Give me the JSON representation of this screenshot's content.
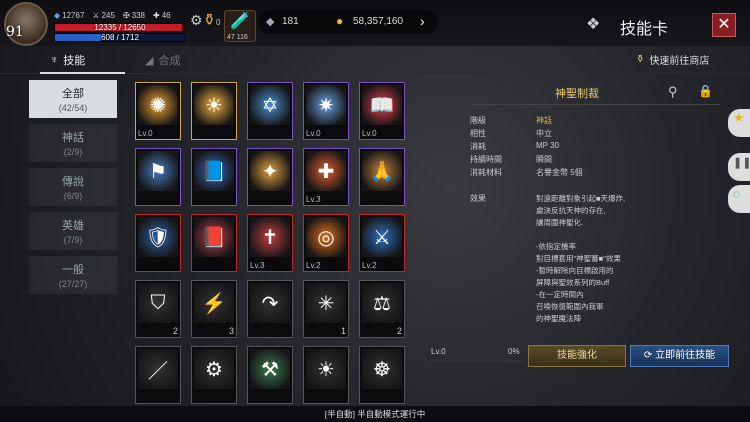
{
  "player": {
    "level": "91",
    "stat1": "12767",
    "stat2": "245",
    "stat3": "338",
    "stat4": "46",
    "hp": "12335 / 12650",
    "mp": "608 / 1712",
    "hp_ratio": 0.975,
    "mp_ratio": 0.355,
    "buff_count": "0",
    "potion_count": "47 116"
  },
  "currency": {
    "crystals": "181",
    "gold": "58,357,160"
  },
  "header": {
    "title": "技能卡",
    "close": "✕"
  },
  "tabs": {
    "skills": "技能",
    "craft": "合成",
    "shop": "快速前往商店"
  },
  "categories": [
    {
      "name": "全部",
      "count": "(42/54)"
    },
    {
      "name": "神話",
      "count": "(2/9)"
    },
    {
      "name": "傳說",
      "count": "(6/9)"
    },
    {
      "name": "英雄",
      "count": "(7/9)"
    },
    {
      "name": "一般",
      "count": "(27/27)"
    }
  ],
  "cells": [
    {
      "lb": "Lv.0",
      "cnt": "",
      "icon": "✺",
      "bg": "#f0a030",
      "bd": "#d4a540"
    },
    {
      "lb": "",
      "cnt": "",
      "icon": "☀",
      "bg": "#f0b040",
      "bd": "#d4a540"
    },
    {
      "lb": "",
      "cnt": "",
      "icon": "✡",
      "bg": "#4a8fd0",
      "bd": "#7a4fc0"
    },
    {
      "lb": "Lv.0",
      "cnt": "",
      "icon": "✷",
      "bg": "#6aa0e0",
      "bd": "#7a4fc0"
    },
    {
      "lb": "Lv.0",
      "cnt": "",
      "icon": "📖",
      "bg": "#e04050",
      "bd": "#7a4fc0"
    },
    {
      "lb": "",
      "cnt": "",
      "icon": "⚑",
      "bg": "#4a7ac0",
      "bd": "#7a4fc0"
    },
    {
      "lb": "",
      "cnt": "",
      "icon": "📘",
      "bg": "#3a6ac0",
      "bd": "#7a4fc0"
    },
    {
      "lb": "",
      "cnt": "",
      "icon": "✦",
      "bg": "#e0a040",
      "bd": "#7a4fc0"
    },
    {
      "lb": "Lv.3",
      "cnt": "",
      "icon": "✚",
      "bg": "#e06030",
      "bd": "#7a4fc0"
    },
    {
      "lb": "",
      "cnt": "",
      "icon": "🙏",
      "bg": "#c08040",
      "bd": "#7a4fc0"
    },
    {
      "lb": "",
      "cnt": "",
      "icon": "🛡",
      "bg": "#3060a0",
      "bd": "#c02828"
    },
    {
      "lb": "",
      "cnt": "",
      "icon": "📕",
      "bg": "#c04050",
      "bd": "#c02828"
    },
    {
      "lb": "Lv.3",
      "cnt": "",
      "icon": "✝",
      "bg": "#c04040",
      "bd": "#c02828"
    },
    {
      "lb": "Lv.2",
      "cnt": "",
      "icon": "◎",
      "bg": "#e07020",
      "bd": "#c02828"
    },
    {
      "lb": "Lv.2",
      "cnt": "",
      "icon": "⚔",
      "bg": "#3070c0",
      "bd": "#c02828"
    },
    {
      "lb": "",
      "cnt": "2",
      "icon": "⛉",
      "bg": "#333",
      "bd": "#555"
    },
    {
      "lb": "",
      "cnt": "3",
      "icon": "⚡",
      "bg": "#333",
      "bd": "#555"
    },
    {
      "lb": "",
      "cnt": "",
      "icon": "↷",
      "bg": "#333",
      "bd": "#555"
    },
    {
      "lb": "",
      "cnt": "1",
      "icon": "✳",
      "bg": "#333",
      "bd": "#555"
    },
    {
      "lb": "",
      "cnt": "2",
      "icon": "⚖",
      "bg": "#333",
      "bd": "#555"
    },
    {
      "lb": "",
      "cnt": "",
      "icon": "／",
      "bg": "#333",
      "bd": "#555"
    },
    {
      "lb": "",
      "cnt": "",
      "icon": "⚙",
      "bg": "#333",
      "bd": "#555"
    },
    {
      "lb": "",
      "cnt": "",
      "icon": "⚒",
      "bg": "#3a7a50",
      "bd": "#555"
    },
    {
      "lb": "",
      "cnt": "",
      "icon": "☀",
      "bg": "#333",
      "bd": "#555"
    },
    {
      "lb": "",
      "cnt": "",
      "icon": "☸",
      "bg": "#333",
      "bd": "#555"
    }
  ],
  "detail": {
    "title": "神聖制裁",
    "rows": [
      {
        "k": "階級",
        "v": "神話"
      },
      {
        "k": "相性",
        "v": "中立"
      },
      {
        "k": "消耗",
        "v": "MP 30"
      },
      {
        "k": "持續時間",
        "v": "瞬間"
      },
      {
        "k": "消耗材料",
        "v": "名譽金幣 5個"
      }
    ],
    "effect_label": "效果",
    "effect_text": "對遠距離對象引起■天爆炸,\n處決反抗天神的存在,\n讓周圍神聖化.\n\n-依指定機率\n對目標套用\"神聖審■\"效果\n-暫時解除向目標啟用的\n屏障與聖效系列的Buff\n-在一定時間內\n召喚恢復範圍內我軍\n的神聖魔法陣",
    "level": "Lv.0",
    "percent": "0%",
    "upgrade": "技能強化",
    "goto": "立即前往技能"
  },
  "status": "[半自動] 半自動模式運行中"
}
